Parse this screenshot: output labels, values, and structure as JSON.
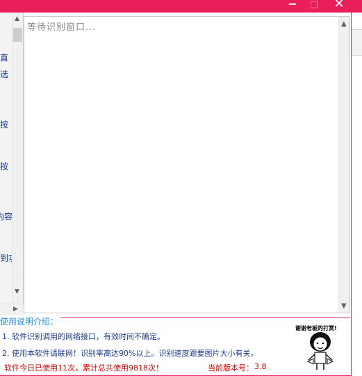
{
  "window": {
    "accent_color": "#ea1f5a",
    "controls": {
      "minimize": "−",
      "maximize": "□",
      "close": "✕"
    }
  },
  "left_panel": {
    "fragments": [
      "直",
      "选",
      "按",
      "按",
      "内容",
      "到功"
    ]
  },
  "result_box": {
    "placeholder": "等待识别窗口..."
  },
  "help": {
    "title": "使用说明介绍：",
    "lines": [
      "1. 软件识别调用的网络接口，有效时间不确定。",
      "2. 使用本软件请联网！识别率高达90%以上。识别速度跟要图片大小有关。"
    ],
    "usage": "软件今日已使用11次，累计总共使用9818次！",
    "version_label": "当前版本号：",
    "version_value": "3.8"
  },
  "thanks_image": {
    "caption": "谢谢老板的打赏!"
  }
}
